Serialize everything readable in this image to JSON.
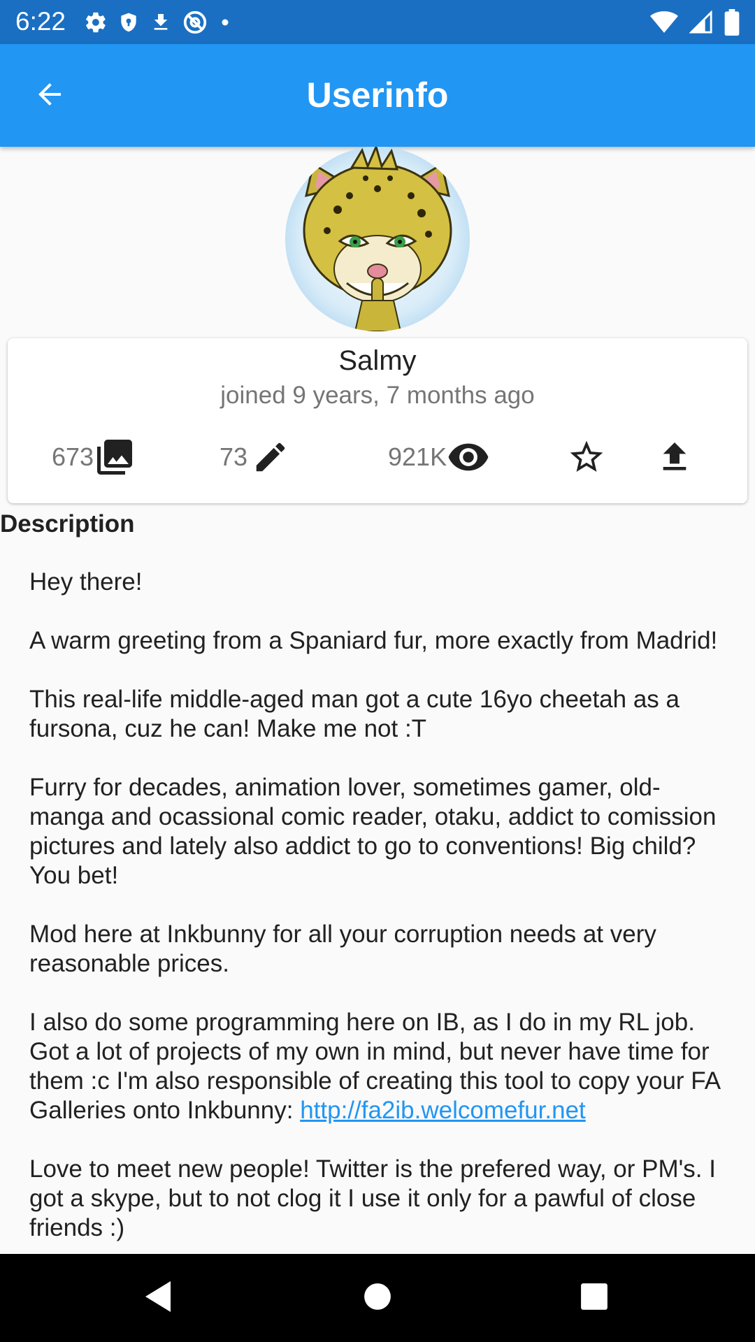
{
  "status_bar": {
    "time": "6:22",
    "icons_left": [
      "gear-icon",
      "shield-icon",
      "download-icon",
      "at-sign-icon",
      "dot-icon"
    ],
    "icons_right": [
      "wifi-icon",
      "cellular-signal-icon",
      "battery-icon"
    ]
  },
  "app_bar": {
    "title": "Userinfo",
    "back_icon": "arrow-back-icon"
  },
  "profile": {
    "username": "Salmy",
    "joined": "joined  9 years, 7 months ago",
    "stats": {
      "submissions": "673",
      "journals": "73",
      "views": "921K"
    },
    "actions": [
      "star-icon",
      "upload-icon"
    ]
  },
  "description": {
    "title": "Description",
    "paragraphs": [
      "Hey there!",
      "A warm greeting from a Spaniard fur, more exactly from Madrid!",
      "This real-life middle-aged man got a cute 16yo cheetah as a fursona, cuz he can! Make me not :T",
      "Furry for decades, animation lover, sometimes gamer, old-manga and ocassional comic reader, otaku, addict to comission pictures and lately also addict to go to conventions! Big child? You bet!",
      "Mod here at Inkbunny for all your corruption needs at very reasonable prices.",
      "I also do some programming here on IB, as I do in my RL job. Got a lot of projects of my own in mind, but never have time for them :c I'm also responsible of creating this tool to copy your FA Galleries onto Inkbunny:",
      "Love to meet new people! Twitter is the prefered way, or PM's. I got a skype, but to not clog it I use it only for a pawful of close friends :)"
    ],
    "link": "http://fa2ib.welcomefur.net"
  },
  "nav_bar": {
    "icons": [
      "back-triangle-icon",
      "home-circle-icon",
      "recents-square-icon"
    ]
  }
}
